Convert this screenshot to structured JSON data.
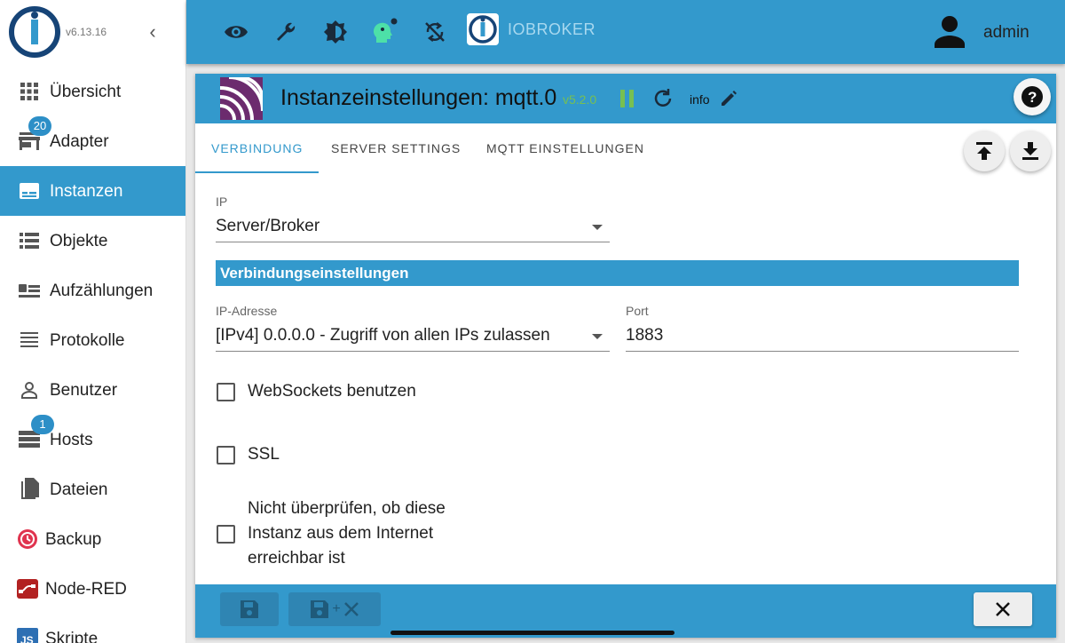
{
  "app": {
    "version": "v6.13.16",
    "brand": "IOBROKER",
    "user": "admin"
  },
  "sidebar": {
    "items": [
      {
        "label": "Übersicht",
        "icon": "grid-icon"
      },
      {
        "label": "Adapter",
        "icon": "store-icon",
        "badge": "20"
      },
      {
        "label": "Instanzen",
        "icon": "instances-icon",
        "active": true
      },
      {
        "label": "Objekte",
        "icon": "list-icon"
      },
      {
        "label": "Aufzählungen",
        "icon": "enums-icon"
      },
      {
        "label": "Protokolle",
        "icon": "log-icon"
      },
      {
        "label": "Benutzer",
        "icon": "user-icon"
      },
      {
        "label": "Hosts",
        "icon": "hosts-icon",
        "badge": "1"
      },
      {
        "label": "Dateien",
        "icon": "files-icon"
      },
      {
        "label": "Backup",
        "icon": "backup-icon"
      },
      {
        "label": "Node-RED",
        "icon": "node-red-icon"
      },
      {
        "label": "Skripte",
        "icon": "scripts-icon"
      }
    ]
  },
  "topbar": {
    "icons": [
      "eye-icon",
      "wrench-icon",
      "theme-icon",
      "expert-mode-icon",
      "sync-off-icon"
    ]
  },
  "instance": {
    "title": "Instanzeinstellungen: mqtt.0",
    "version": "v5.2.0",
    "info_label": "info"
  },
  "tabs": [
    {
      "label": "VERBINDUNG",
      "active": true
    },
    {
      "label": "SERVER SETTINGS"
    },
    {
      "label": "MQTT EINSTELLUNGEN"
    }
  ],
  "form": {
    "ip_type_label": "IP",
    "ip_type_value": "Server/Broker",
    "section_title": "Verbindungseinstellungen",
    "ip_address_label": "IP-Adresse",
    "ip_address_value": "[IPv4] 0.0.0.0 - Zugriff von allen IPs zulassen",
    "port_label": "Port",
    "port_value": "1883",
    "websockets_label": "WebSockets benutzen",
    "ssl_label": "SSL",
    "no_check_label_line1": "Nicht überprüfen, ob diese",
    "no_check_label_line2": "Instanz aus dem Internet",
    "no_check_label_line3": "erreichbar ist",
    "websockets_checked": false,
    "ssl_checked": false,
    "no_check_checked": false
  },
  "colors": {
    "primary": "#3399cc",
    "version_green": "#77c052",
    "mqtt_purple": "#6c2b6e"
  }
}
